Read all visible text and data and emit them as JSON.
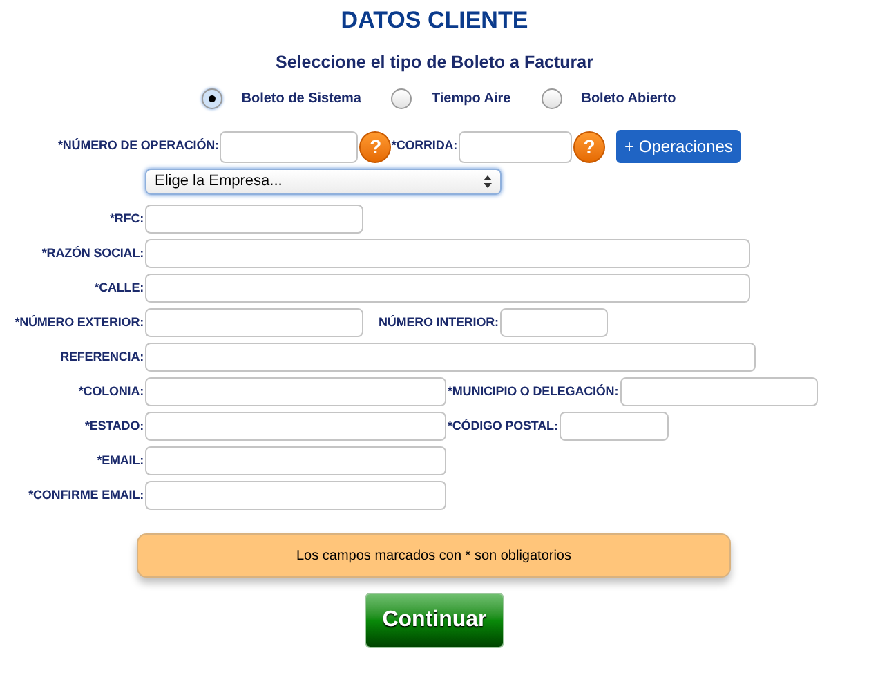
{
  "title": "DATOS CLIENTE",
  "subtitle": "Seleccione el tipo de Boleto a Facturar",
  "ticket_types": [
    {
      "label": "Boleto de Sistema",
      "selected": true
    },
    {
      "label": "Tiempo Aire",
      "selected": false
    },
    {
      "label": "Boleto Abierto",
      "selected": false
    }
  ],
  "operation": {
    "fields": [
      {
        "label": "*NÚMERO DE OPERACIÓN:",
        "help": "?"
      },
      {
        "label": "*CORRIDA:",
        "help": "?"
      }
    ],
    "button": "+ Operaciones"
  },
  "company_select": {
    "value": "Elige la Empresa..."
  },
  "form_rows": [
    [
      {
        "label": "*RFC:"
      }
    ],
    [
      {
        "label": "*RAZÓN SOCIAL:"
      }
    ],
    [
      {
        "label": "*CALLE:"
      }
    ],
    [
      {
        "label": "*NÚMERO EXTERIOR:"
      },
      {
        "label": "NÚMERO INTERIOR:"
      }
    ],
    [
      {
        "label": "REFERENCIA:"
      }
    ],
    [
      {
        "label": "*COLONIA:"
      },
      {
        "label": "*MUNICIPIO O DELEGACIÓN:"
      }
    ],
    [
      {
        "label": "*ESTADO:"
      },
      {
        "label": "*CÓDIGO POSTAL:"
      }
    ],
    [
      {
        "label": "*EMAIL:"
      }
    ],
    [
      {
        "label": "*CONFIRME EMAIL:"
      }
    ]
  ],
  "notice": "Los campos marcados con * son obligatorios",
  "submit": "Continuar"
}
